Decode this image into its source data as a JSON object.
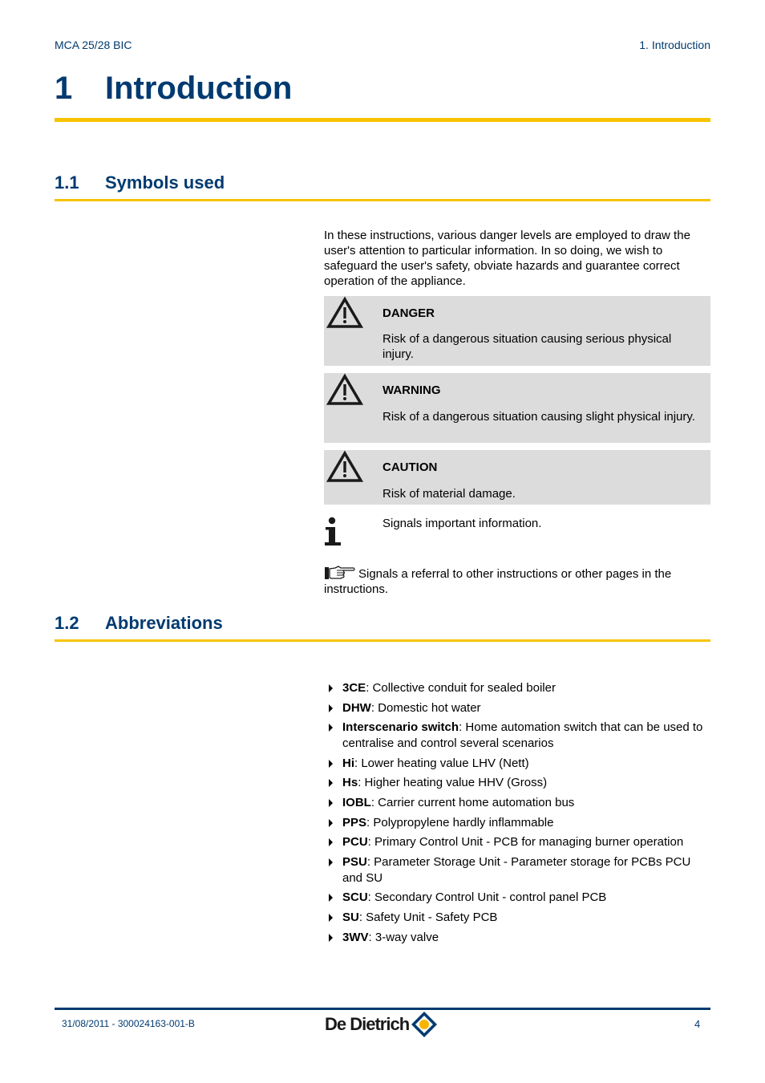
{
  "header": {
    "doc_model": "MCA 25/28 BIC",
    "section_ref": "1.  Introduction"
  },
  "chapter": {
    "number": "1",
    "title": "Introduction"
  },
  "sections": [
    {
      "number": "1.1",
      "title": "Symbols used"
    },
    {
      "number": "1.2",
      "title": "Abbreviations"
    }
  ],
  "symbols": {
    "intro": "In these instructions, various danger levels are employed to draw the user's attention to particular information. In so doing, we wish to safeguard the user's safety, obviate hazards and guarantee correct operation of the appliance.",
    "boxes": [
      {
        "icon": "warning-triangle-icon",
        "title": "DANGER",
        "text": "Risk of a dangerous situation causing serious physical injury."
      },
      {
        "icon": "warning-triangle-icon",
        "title": "WARNING",
        "text": "Risk of a dangerous situation causing slight physical injury."
      },
      {
        "icon": "warning-triangle-icon",
        "title": "CAUTION",
        "text": "Risk of material damage."
      }
    ],
    "info": {
      "icon": "info-icon",
      "text": "Signals important information."
    },
    "referral": {
      "icon": "pointing-hand-icon",
      "text": "Signals a referral to other instructions or other pages in the instructions."
    }
  },
  "abbreviations": [
    {
      "term": "3CE",
      "definition": ": Collective conduit for sealed boiler"
    },
    {
      "term": "DHW",
      "definition": ": Domestic hot water"
    },
    {
      "term": "Interscenario switch",
      "definition": ": Home automation switch that can be used to centralise and control several scenarios"
    },
    {
      "term": "Hi",
      "definition": ": Lower heating value LHV (Nett)"
    },
    {
      "term": "Hs",
      "definition": ": Higher heating value HHV (Gross)"
    },
    {
      "term": "IOBL",
      "definition": ": Carrier current home automation bus"
    },
    {
      "term": "PPS",
      "definition": ": Polypropylene hardly inflammable"
    },
    {
      "term": "PCU",
      "definition": ": Primary Control Unit - PCB for managing burner operation"
    },
    {
      "term": "PSU",
      "definition": ": Parameter Storage Unit - Parameter storage for PCBs PCU and SU"
    },
    {
      "term": "SCU",
      "definition": ": Secondary Control Unit -  control panel PCB"
    },
    {
      "term": "SU",
      "definition": ": Safety Unit - Safety PCB"
    },
    {
      "term": "3WV",
      "definition": ": 3-way valve"
    }
  ],
  "footer": {
    "doc_ref": "31/08/2011  - 300024163-001-B",
    "brand": "De Dietrich",
    "page_number": "4"
  },
  "colors": {
    "heading_blue": "#003a70",
    "accent_yellow": "#f8c400",
    "box_grey": "#dcdcdc"
  }
}
